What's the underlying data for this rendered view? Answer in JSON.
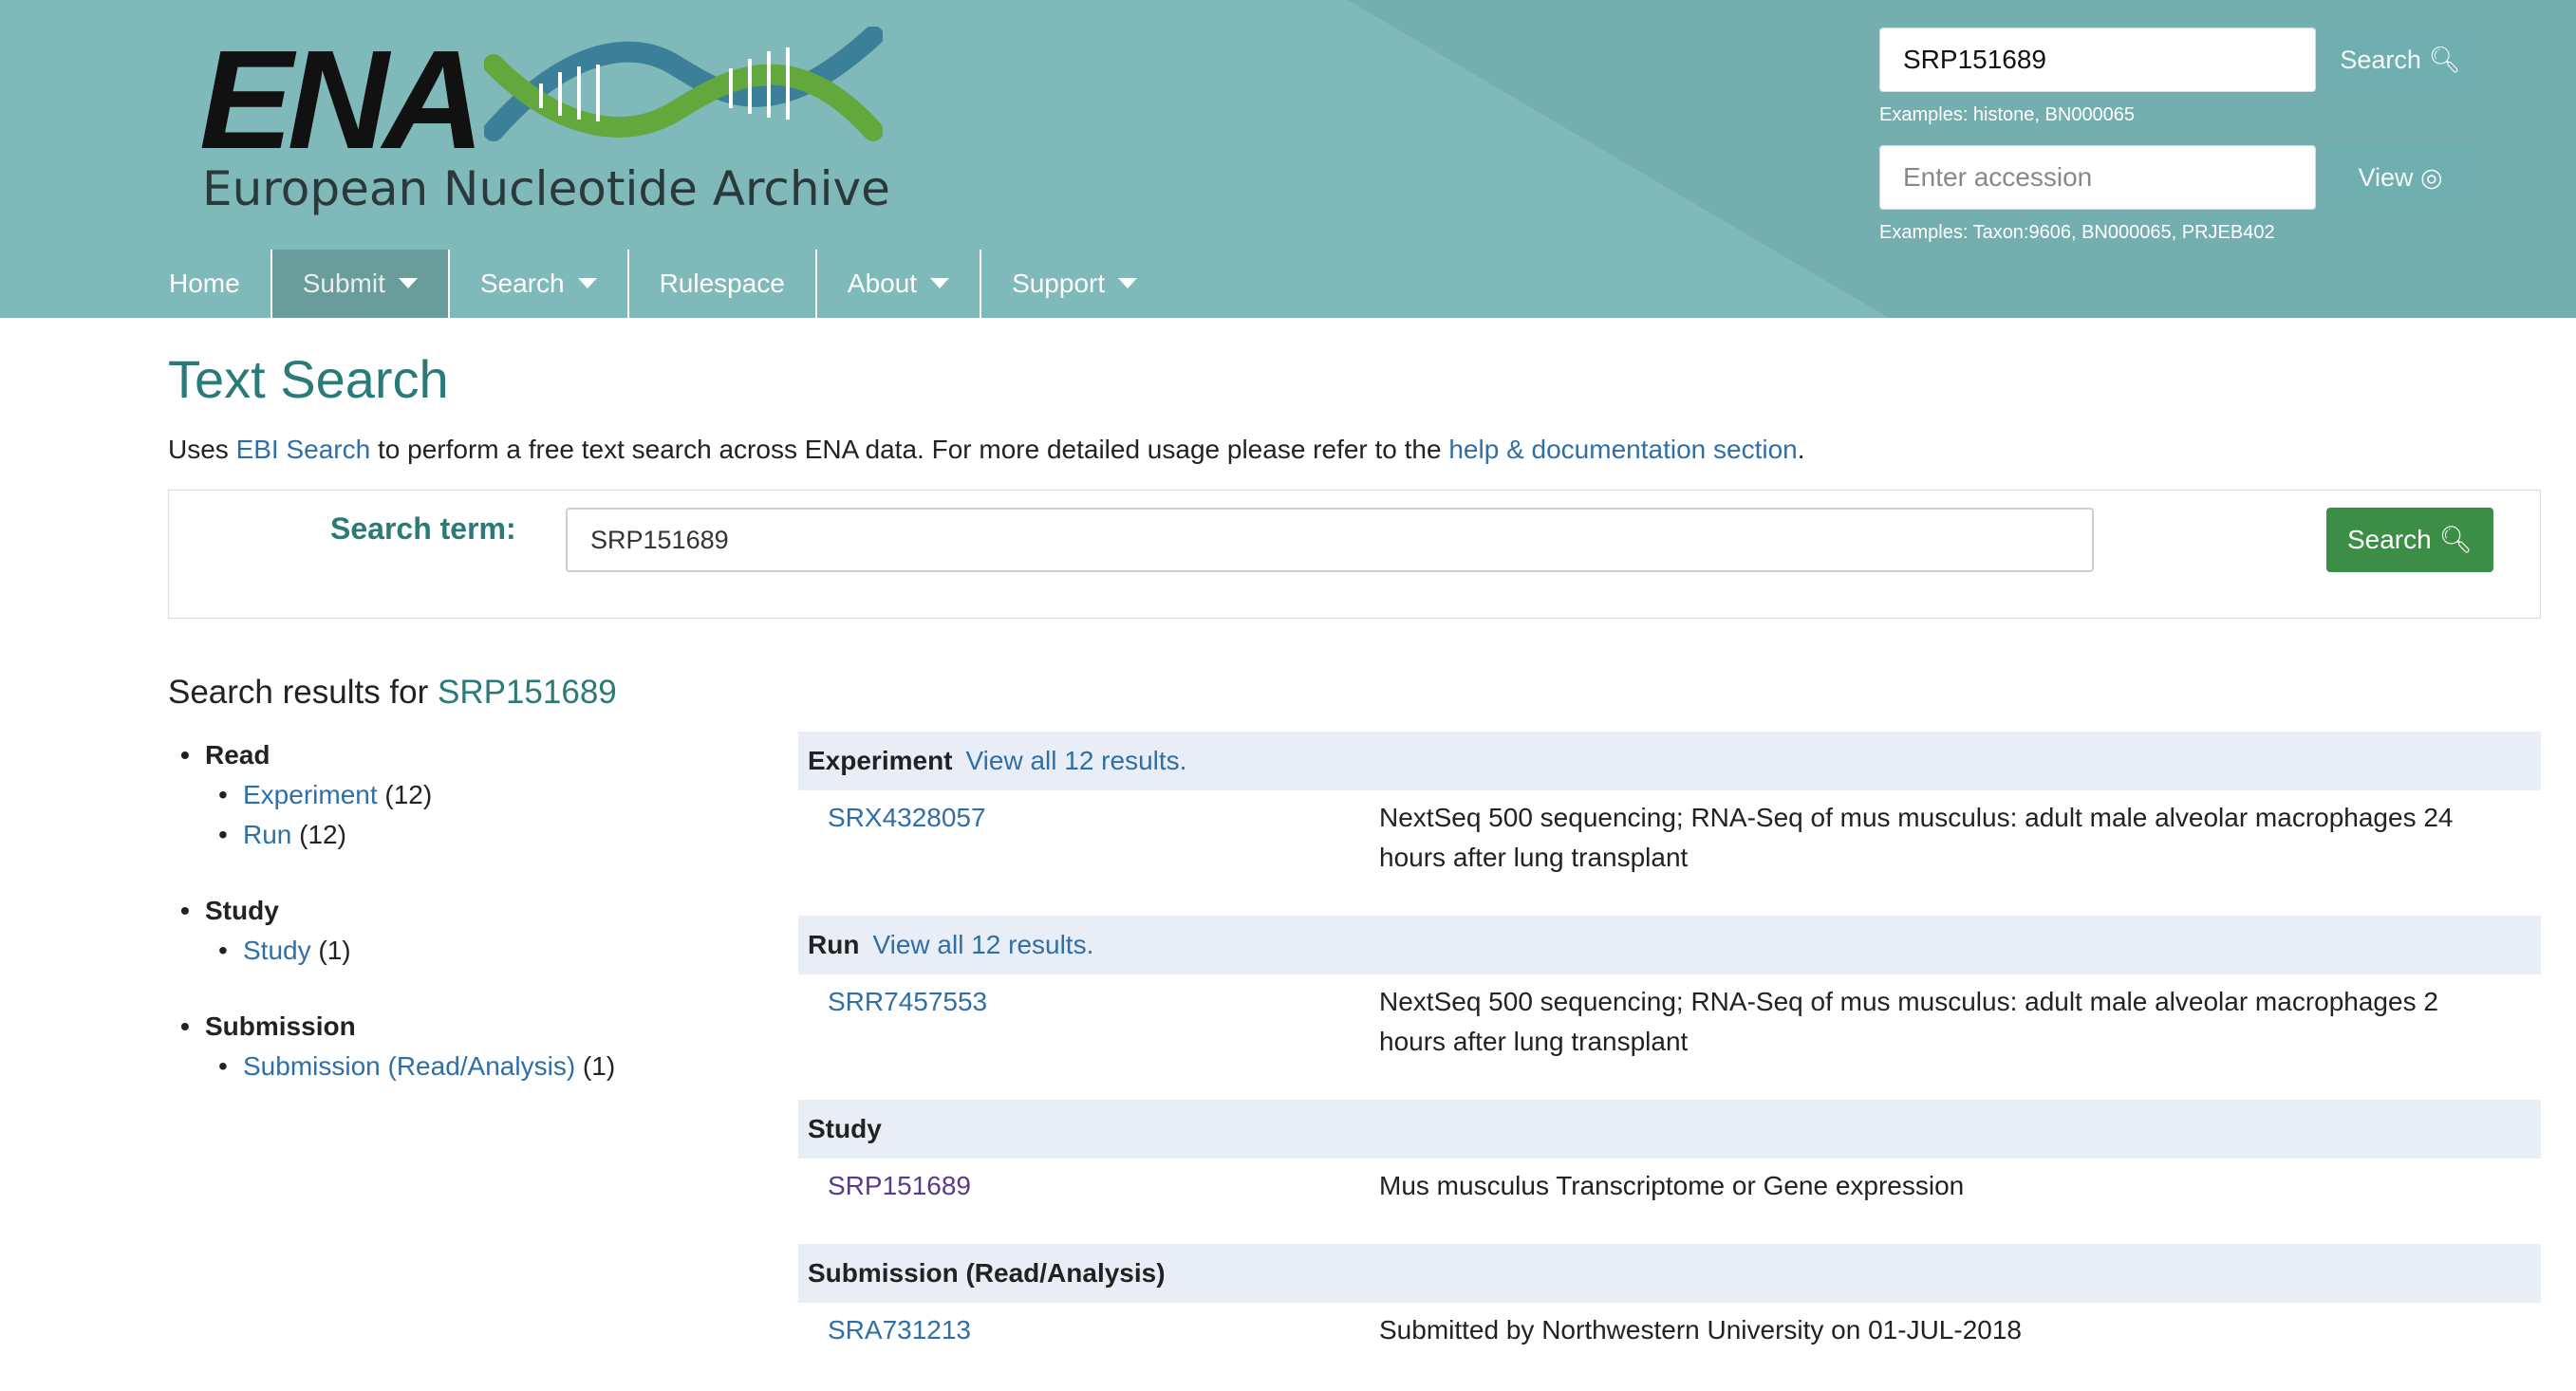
{
  "header": {
    "logo_text": "ENA",
    "logo_subtitle": "European Nucleotide Archive",
    "search_value": "SRP151689",
    "search_button": "Search",
    "search_examples": "Examples: histone, BN000065",
    "accession_placeholder": "Enter accession",
    "view_button": "View",
    "accession_examples": "Examples: Taxon:9606, BN000065, PRJEB402"
  },
  "nav": {
    "items": [
      {
        "label": "Home"
      },
      {
        "label": "Submit"
      },
      {
        "label": "Search"
      },
      {
        "label": "Rulespace"
      },
      {
        "label": "About"
      },
      {
        "label": "Support"
      }
    ]
  },
  "page": {
    "title": "Text Search",
    "desc_prefix": "Uses ",
    "desc_link1": "EBI Search",
    "desc_middle": " to perform a free text search across ENA data. For more detailed usage please refer to the ",
    "desc_link2": "help & documentation section",
    "desc_suffix": "."
  },
  "search_panel": {
    "label": "Search term:",
    "value": "SRP151689",
    "button": "Search"
  },
  "results": {
    "heading_prefix": "Search results for ",
    "heading_term": "SRP151689"
  },
  "facets": [
    {
      "title": "Read",
      "items": [
        {
          "label": "Experiment",
          "count": "(12)"
        },
        {
          "label": "Run",
          "count": "(12)"
        }
      ]
    },
    {
      "title": "Study",
      "items": [
        {
          "label": "Study",
          "count": "(1)"
        }
      ]
    },
    {
      "title": "Submission",
      "items": [
        {
          "label": "Submission (Read/Analysis)",
          "count": "(1)"
        }
      ]
    }
  ],
  "sections": [
    {
      "title": "Experiment",
      "view_all": "View all 12 results.",
      "accession": "SRX4328057",
      "description": "NextSeq 500 sequencing; RNA-Seq of mus musculus: adult male alveolar macrophages 24 hours after lung transplant"
    },
    {
      "title": "Run",
      "view_all": "View all 12 results.",
      "accession": "SRR7457553",
      "description": "NextSeq 500 sequencing; RNA-Seq of mus musculus: adult male alveolar macrophages 2 hours after lung transplant"
    },
    {
      "title": "Study",
      "view_all": "",
      "accession": "SRP151689",
      "description": "Mus musculus Transcriptome or Gene expression"
    },
    {
      "title": "Submission (Read/Analysis)",
      "view_all": "",
      "accession": "SRA731213",
      "description": "Submitted by Northwestern University on 01-JUL-2018"
    }
  ],
  "colors": {
    "header_bg": "#80b9b9",
    "accent": "#2b7a7a",
    "link": "#2f6fa8",
    "green_button": "#3c8e46",
    "section_bg": "#e9edf5"
  }
}
